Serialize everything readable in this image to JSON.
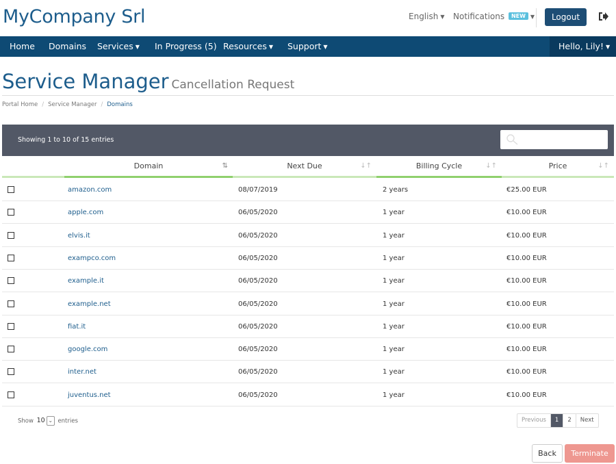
{
  "header": {
    "company": "MyCompany Srl",
    "language": "English",
    "notifications": "Notifications",
    "notifications_badge": "NEW",
    "logout": "Logout"
  },
  "nav": {
    "items": [
      "Home",
      "Domains",
      "Services",
      "In Progress (5)",
      "Resources",
      "Support"
    ],
    "user": "Hello, Lily!"
  },
  "page": {
    "title": "Service Manager",
    "subtitle": "Cancellation Request",
    "breadcrumb": [
      "Portal Home",
      "Service Manager",
      "Domains"
    ]
  },
  "table": {
    "info": "Showing 1 to 10 of 15 entries",
    "search_value": "",
    "columns": [
      "Domain",
      "Next Due",
      "Billing Cycle",
      "Price"
    ],
    "rows": [
      {
        "domain": "amazon.com",
        "due": "08/07/2019",
        "cycle": "2 years",
        "price": "€25.00 EUR"
      },
      {
        "domain": "apple.com",
        "due": "06/05/2020",
        "cycle": "1 year",
        "price": "€10.00 EUR"
      },
      {
        "domain": "elvis.it",
        "due": "06/05/2020",
        "cycle": "1 year",
        "price": "€10.00 EUR"
      },
      {
        "domain": "exampco.com",
        "due": "06/05/2020",
        "cycle": "1 year",
        "price": "€10.00 EUR"
      },
      {
        "domain": "example.it",
        "due": "06/05/2020",
        "cycle": "1 year",
        "price": "€10.00 EUR"
      },
      {
        "domain": "example.net",
        "due": "06/05/2020",
        "cycle": "1 year",
        "price": "€10.00 EUR"
      },
      {
        "domain": "fiat.it",
        "due": "06/05/2020",
        "cycle": "1 year",
        "price": "€10.00 EUR"
      },
      {
        "domain": "google.com",
        "due": "06/05/2020",
        "cycle": "1 year",
        "price": "€10.00 EUR"
      },
      {
        "domain": "inter.net",
        "due": "06/05/2020",
        "cycle": "1 year",
        "price": "€10.00 EUR"
      },
      {
        "domain": "juventus.net",
        "due": "06/05/2020",
        "cycle": "1 year",
        "price": "€10.00 EUR"
      }
    ]
  },
  "footer": {
    "show_label": "Show",
    "entries_value": "10",
    "entries_label": "entries",
    "pager": {
      "previous": "Previous",
      "pages": [
        "1",
        "2"
      ],
      "next": "Next"
    },
    "back": "Back",
    "terminate": "Terminate"
  },
  "colors": {
    "brand": "#1d5d8c",
    "nav": "#0e4a74",
    "table_bar": "#525866",
    "sort_accent": "#8fd06d",
    "terminate": "#ee9790"
  }
}
